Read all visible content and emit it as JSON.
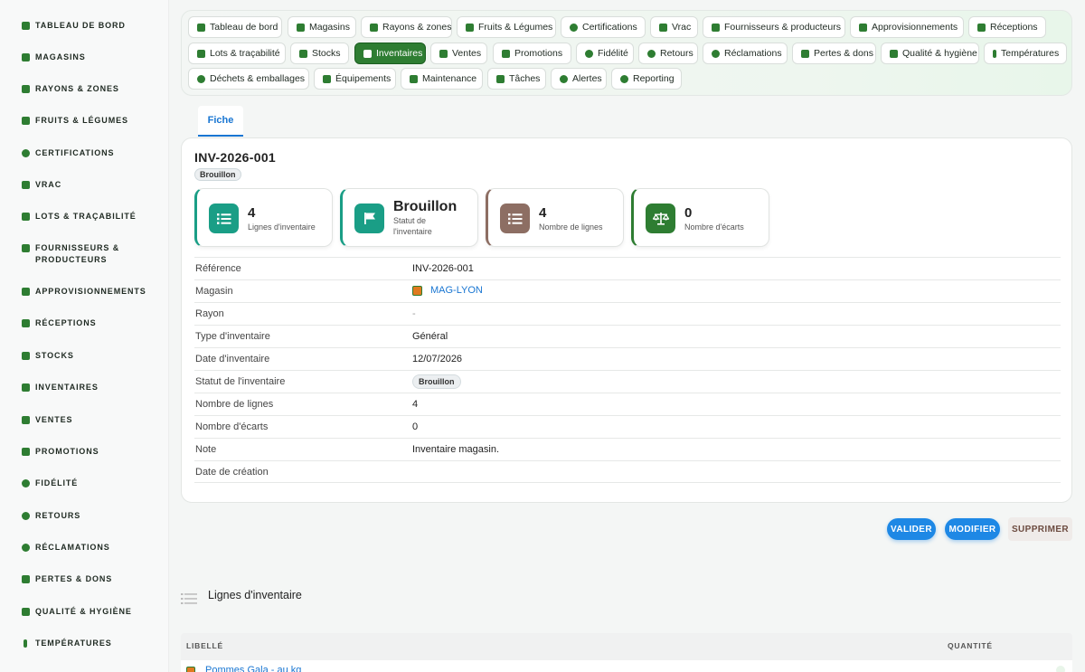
{
  "sidebar": {
    "items": [
      {
        "label": "Tableau de bord",
        "icon": "leaf-icon"
      },
      {
        "label": "Magasins",
        "icon": "store-icon"
      },
      {
        "label": "Rayons & zones",
        "icon": "grid-icon"
      },
      {
        "label": "Fruits & légumes",
        "icon": "leaf-icon"
      },
      {
        "label": "Certifications",
        "icon": "badge-icon"
      },
      {
        "label": "Vrac",
        "icon": "scale-icon"
      },
      {
        "label": "Lots & traçabilité",
        "icon": "barcode-icon"
      },
      {
        "label": "Fournisseurs & producteurs",
        "icon": "tractor-icon"
      },
      {
        "label": "Approvisionnements",
        "icon": "sprout-icon"
      },
      {
        "label": "Réceptions",
        "icon": "truck-icon"
      },
      {
        "label": "Stocks",
        "icon": "warehouse-icon"
      },
      {
        "label": "Inventaires",
        "icon": "clipboard-icon"
      },
      {
        "label": "Ventes",
        "icon": "cash-register-icon"
      },
      {
        "label": "Promotions",
        "icon": "tag-icon"
      },
      {
        "label": "Fidélité",
        "icon": "award-icon"
      },
      {
        "label": "Retours",
        "icon": "undo-icon"
      },
      {
        "label": "Réclamations",
        "icon": "comment-icon"
      },
      {
        "label": "Pertes & dons",
        "icon": "trash-icon"
      },
      {
        "label": "Qualité & hygiène",
        "icon": "clipboard-check-icon"
      },
      {
        "label": "Températures",
        "icon": "thermometer-icon"
      }
    ]
  },
  "topnav": {
    "chips": [
      {
        "label": "Tableau de bord",
        "icon": "leaf-icon"
      },
      {
        "label": "Magasins",
        "icon": "store-icon"
      },
      {
        "label": "Rayons & zones",
        "icon": "grid-icon"
      },
      {
        "label": "Fruits & Légumes",
        "icon": "leaf-icon"
      },
      {
        "label": "Certifications",
        "icon": "badge-icon"
      },
      {
        "label": "Vrac",
        "icon": "scale-icon"
      },
      {
        "label": "Fournisseurs & producteurs",
        "icon": "tractor-icon"
      },
      {
        "label": "Approvisionnements",
        "icon": "sprout-icon"
      },
      {
        "label": "Réceptions",
        "icon": "truck-icon"
      },
      {
        "label": "Lots & traçabilité",
        "icon": "barcode-icon"
      },
      {
        "label": "Stocks",
        "icon": "warehouse-icon"
      },
      {
        "label": "Inventaires",
        "icon": "clipboard-icon"
      },
      {
        "label": "Ventes",
        "icon": "cash-register-icon"
      },
      {
        "label": "Promotions",
        "icon": "tag-icon"
      },
      {
        "label": "Fidélité",
        "icon": "award-icon"
      },
      {
        "label": "Retours",
        "icon": "undo-icon"
      },
      {
        "label": "Réclamations",
        "icon": "comment-icon"
      },
      {
        "label": "Pertes & dons",
        "icon": "trash-icon"
      },
      {
        "label": "Qualité & hygiène",
        "icon": "clipboard-check-icon"
      },
      {
        "label": "Températures",
        "icon": "thermometer-icon"
      },
      {
        "label": "Déchets & emballages",
        "icon": "recycle-icon"
      },
      {
        "label": "Équipements",
        "icon": "tools-icon"
      },
      {
        "label": "Maintenance",
        "icon": "wrench-icon"
      },
      {
        "label": "Tâches",
        "icon": "list-icon"
      },
      {
        "label": "Alertes",
        "icon": "bell-icon"
      },
      {
        "label": "Reporting",
        "icon": "pie-chart-icon"
      }
    ],
    "active": "Inventaires"
  },
  "tabs": {
    "fiche": "Fiche"
  },
  "record": {
    "title": "INV-2026-001",
    "status_badge": "Brouillon"
  },
  "stats": [
    {
      "value": "4",
      "label": "Lignes d'inventaire",
      "color": "#1a9e86",
      "accent": "#1a9e86",
      "icon": "list-icon"
    },
    {
      "value": "Brouillon",
      "label": "Statut de l'inventaire",
      "color": "#1a9e86",
      "accent": "#1a9e86",
      "icon": "flag-icon"
    },
    {
      "value": "4",
      "label": "Nombre de lignes",
      "color": "#8d6e63",
      "accent": "#8d6e63",
      "icon": "list-icon"
    },
    {
      "value": "0",
      "label": "Nombre d'écarts",
      "color": "#2e7d32",
      "accent": "#2e7d32",
      "icon": "balance-scale-icon"
    }
  ],
  "fields": [
    {
      "label": "Référence",
      "value": "INV-2026-001"
    },
    {
      "label": "Magasin",
      "value": "MAG-LYON"
    },
    {
      "label": "Rayon",
      "value": "-"
    },
    {
      "label": "Type d'inventaire",
      "value": "Général"
    },
    {
      "label": "Date d'inventaire",
      "value": "12/07/2026"
    },
    {
      "label": "Statut de l'inventaire",
      "value": "Brouillon"
    },
    {
      "label": "Nombre de lignes",
      "value": "4"
    },
    {
      "label": "Nombre d'écarts",
      "value": "0"
    },
    {
      "label": "Note",
      "value": "Inventaire magasin."
    },
    {
      "label": "Date de création",
      "value": ""
    }
  ],
  "actions": {
    "validate": "VALIDER",
    "edit": "MODIFIER",
    "delete": "SUPPRIMER"
  },
  "lines_section": {
    "title": "Lignes d'inventaire",
    "columns": [
      "Libellé",
      "Quantité"
    ],
    "rows": [
      {
        "label": "Pommes Gala - au kg"
      }
    ]
  },
  "colors": {
    "brand": "#2e7d32",
    "link": "#1976d2",
    "primary_button": "#1e88e5"
  }
}
